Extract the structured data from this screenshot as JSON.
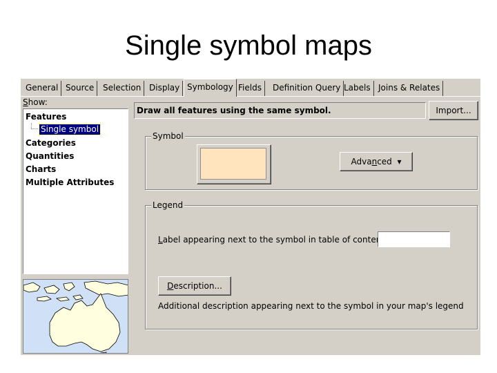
{
  "slide": {
    "title": "Single symbol maps"
  },
  "tabs": [
    {
      "label": "General"
    },
    {
      "label": "Source"
    },
    {
      "label": "Selection"
    },
    {
      "label": "Display"
    },
    {
      "label": "Symbology"
    },
    {
      "label": "Fields"
    },
    {
      "label": "Definition Query"
    },
    {
      "label": "Labels"
    },
    {
      "label": "Joins & Relates"
    }
  ],
  "active_tab": "Symbology",
  "show": {
    "label_first": "S",
    "label_rest": "how:",
    "items": [
      "Features",
      "Categories",
      "Quantities",
      "Charts",
      "Multiple Attributes"
    ],
    "selected_sub": "Single symbol"
  },
  "draw_description": "Draw all features using the same symbol.",
  "import_button": "Import...",
  "symbol_group": {
    "title": "Symbol",
    "swatch_color": "#ffe4be",
    "advanced_pre": "Adva",
    "advanced_u": "n",
    "advanced_post": "ced",
    "advanced_arrow": "▾"
  },
  "legend_group": {
    "title": "Legend",
    "label_prompt_u": "L",
    "label_prompt_rest": "abel appearing next to the symbol in table of contents:",
    "label_value": "",
    "desc_u": "D",
    "desc_rest": "escription...",
    "additional_text": "Additional description appearing next to the symbol in your map's legend"
  },
  "colors": {
    "dialog_bg": "#d4d0c8",
    "selection_bg": "#000080",
    "map_water": "#cfe0f7",
    "map_land": "#ffffe0"
  },
  "icons": {
    "tree_connector": "tree-connector-icon",
    "dropdown": "dropdown-arrow-icon"
  }
}
